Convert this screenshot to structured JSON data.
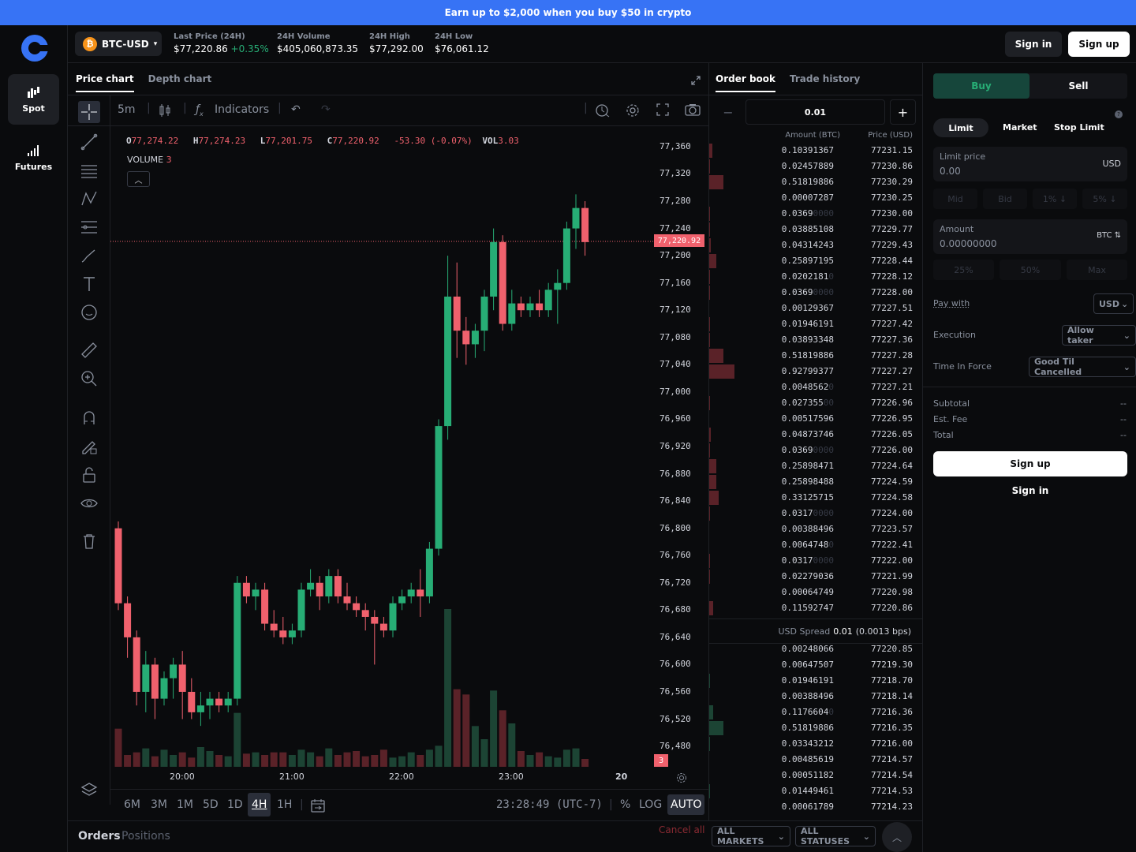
{
  "banner": {
    "text": "Earn up to $2,000 when you buy $50 in crypto"
  },
  "nav": {
    "spot": "Spot",
    "futures": "Futures"
  },
  "header": {
    "pair": "BTC-USD",
    "btc_symbol": "₿",
    "stats": [
      {
        "label": "Last Price (24H)",
        "value": "$77,220.86",
        "change": "+0.35%"
      },
      {
        "label": "24H Volume",
        "value": "$405,060,873.35"
      },
      {
        "label": "24H High",
        "value": "$77,292.00"
      },
      {
        "label": "24H Low",
        "value": "$76,061.12"
      }
    ],
    "sign_in": "Sign in",
    "sign_up": "Sign up"
  },
  "chart_tabs": {
    "price": "Price chart",
    "depth": "Depth chart"
  },
  "toolbar": {
    "interval": "5m",
    "indicators": "Indicators"
  },
  "legend": {
    "o_label": "O",
    "o": "77,274.22",
    "h_label": "H",
    "h": "77,274.23",
    "l_label": "L",
    "l": "77,201.75",
    "c_label": "C",
    "c": "77,220.92",
    "chg": "-53.30 (-0.07%)",
    "vol_label": "VOL",
    "vol": "3.03",
    "volume_label": "VOLUME",
    "volume_val": "3"
  },
  "chart_data": {
    "type": "candlestick",
    "x_ticks": [
      "20:00",
      "21:00",
      "22:00",
      "23:00"
    ],
    "y_ticks": [
      "77,360",
      "77,320",
      "77,280",
      "77,240",
      "77,200",
      "77,160",
      "77,120",
      "77,080",
      "77,040",
      "77,000",
      "76,960",
      "76,920",
      "76,880",
      "76,840",
      "76,800",
      "76,760",
      "76,720",
      "76,680",
      "76,640",
      "76,600",
      "76,560",
      "76,520",
      "76,480"
    ],
    "ylim": [
      76450,
      77390
    ],
    "last_price": "77,220.92",
    "volume_last": "3",
    "x_tail_label": "20",
    "candles": [
      [
        76800,
        76810,
        76680,
        76690
      ],
      [
        76690,
        76700,
        76610,
        76640
      ],
      [
        76640,
        76650,
        76540,
        76560
      ],
      [
        76560,
        76620,
        76530,
        76600
      ],
      [
        76600,
        76610,
        76520,
        76550
      ],
      [
        76550,
        76590,
        76540,
        76580
      ],
      [
        76580,
        76610,
        76550,
        76600
      ],
      [
        76600,
        76620,
        76520,
        76560
      ],
      [
        76560,
        76580,
        76520,
        76530
      ],
      [
        76530,
        76560,
        76510,
        76540
      ],
      [
        76540,
        76560,
        76520,
        76550
      ],
      [
        76550,
        76560,
        76530,
        76540
      ],
      [
        76540,
        76560,
        76530,
        76550
      ],
      [
        76550,
        76730,
        76540,
        76720
      ],
      [
        76720,
        76730,
        76690,
        76700
      ],
      [
        76700,
        76720,
        76680,
        76710
      ],
      [
        76710,
        76720,
        76650,
        76660
      ],
      [
        76660,
        76680,
        76640,
        76650
      ],
      [
        76650,
        76670,
        76630,
        76640
      ],
      [
        76640,
        76660,
        76630,
        76650
      ],
      [
        76650,
        76720,
        76640,
        76710
      ],
      [
        76710,
        76740,
        76700,
        76720
      ],
      [
        76720,
        76730,
        76680,
        76700
      ],
      [
        76700,
        76740,
        76690,
        76730
      ],
      [
        76730,
        76740,
        76690,
        76700
      ],
      [
        76700,
        76720,
        76680,
        76690
      ],
      [
        76690,
        76700,
        76670,
        76680
      ],
      [
        76680,
        76690,
        76650,
        76670
      ],
      [
        76670,
        76680,
        76600,
        76660
      ],
      [
        76660,
        76670,
        76640,
        76650
      ],
      [
        76650,
        76700,
        76640,
        76690
      ],
      [
        76690,
        76710,
        76680,
        76700
      ],
      [
        76700,
        76720,
        76690,
        76710
      ],
      [
        76710,
        76740,
        76670,
        76700
      ],
      [
        76700,
        76780,
        76690,
        76770
      ],
      [
        76770,
        76960,
        76760,
        76950
      ],
      [
        76950,
        77200,
        76930,
        77140
      ],
      [
        77140,
        77190,
        77050,
        77090
      ],
      [
        77090,
        77110,
        77040,
        77070
      ],
      [
        77070,
        77100,
        77050,
        77090
      ],
      [
        77090,
        77150,
        77060,
        77140
      ],
      [
        77140,
        77240,
        77120,
        77220
      ],
      [
        77220,
        77230,
        77090,
        77100
      ],
      [
        77100,
        77150,
        77090,
        77130
      ],
      [
        77130,
        77140,
        77110,
        77120
      ],
      [
        77120,
        77140,
        77110,
        77130
      ],
      [
        77130,
        77150,
        77110,
        77120
      ],
      [
        77120,
        77160,
        77110,
        77150
      ],
      [
        77150,
        77180,
        77100,
        77160
      ],
      [
        77160,
        77250,
        77150,
        77240
      ],
      [
        77240,
        77290,
        77210,
        77270
      ],
      [
        77270,
        77280,
        77200,
        77220
      ]
    ],
    "volumes": [
      2.9,
      0.9,
      1.1,
      1.4,
      0.8,
      1.3,
      0.9,
      1.1,
      0.7,
      1.5,
      1.2,
      0.9,
      0.8,
      4.1,
      1.0,
      1.1,
      0.9,
      1.1,
      1.1,
      0.9,
      1.3,
      1.1,
      0.8,
      1.4,
      0.9,
      1.1,
      1.2,
      0.8,
      0.9,
      1.3,
      0.7,
      0.8,
      1.1,
      0.9,
      1.3,
      1.6,
      12.0,
      5.9,
      5.5,
      3.1,
      2.1,
      5.8,
      4.3,
      3.3,
      1.2,
      0.9,
      1.1,
      0.8,
      0.7,
      1.3,
      1.4,
      0.6
    ]
  },
  "range": {
    "items": [
      "6M",
      "3M",
      "1M",
      "5D",
      "1D",
      "4H",
      "1H"
    ],
    "active": "4H",
    "clock": "23:28:49 (UTC-7)",
    "pct": "%",
    "log": "LOG",
    "auto": "AUTO"
  },
  "orders_bar": {
    "orders": "Orders",
    "positions": "Positions",
    "cancel_all": "Cancel all",
    "all_markets": "ALL MARKETS",
    "all_statuses": "ALL STATUSES"
  },
  "orderbook": {
    "tabs": {
      "book": "Order book",
      "history": "Trade history"
    },
    "increment": "0.01",
    "col_amount": "Amount (BTC)",
    "col_price": "Price (USD)",
    "asks": [
      {
        "a": "0.10391367",
        "d": "",
        "p": "77231.15",
        "v": 0.04
      },
      {
        "a": "0.02457889",
        "d": "",
        "p": "77230.86",
        "v": 0.01
      },
      {
        "a": "0.51819886",
        "d": "",
        "p": "77230.29",
        "v": 0.2
      },
      {
        "a": "0.00007287",
        "d": "",
        "p": "77230.25",
        "v": 0
      },
      {
        "a": "0.0369",
        "d": "0000",
        "p": "77230.00",
        "v": 0.01
      },
      {
        "a": "0.03885108",
        "d": "",
        "p": "77229.77",
        "v": 0.01
      },
      {
        "a": "0.04314243",
        "d": "",
        "p": "77229.43",
        "v": 0.02
      },
      {
        "a": "0.25897195",
        "d": "",
        "p": "77228.44",
        "v": 0.1
      },
      {
        "a": "0.0202181",
        "d": "0",
        "p": "77228.12",
        "v": 0.01
      },
      {
        "a": "0.0369",
        "d": "0000",
        "p": "77228.00",
        "v": 0.01
      },
      {
        "a": "0.00129367",
        "d": "",
        "p": "77227.51",
        "v": 0
      },
      {
        "a": "0.01946191",
        "d": "",
        "p": "77227.42",
        "v": 0.01
      },
      {
        "a": "0.03893348",
        "d": "",
        "p": "77227.36",
        "v": 0.01
      },
      {
        "a": "0.51819886",
        "d": "",
        "p": "77227.28",
        "v": 0.2
      },
      {
        "a": "0.92799377",
        "d": "",
        "p": "77227.27",
        "v": 0.35
      },
      {
        "a": "0.0048562",
        "d": "0",
        "p": "77227.21",
        "v": 0
      },
      {
        "a": "0.027355",
        "d": "00",
        "p": "77226.96",
        "v": 0.01
      },
      {
        "a": "0.00517596",
        "d": "",
        "p": "77226.95",
        "v": 0
      },
      {
        "a": "0.04873746",
        "d": "",
        "p": "77226.05",
        "v": 0.02
      },
      {
        "a": "0.0369",
        "d": "0000",
        "p": "77226.00",
        "v": 0.01
      },
      {
        "a": "0.25898471",
        "d": "",
        "p": "77224.64",
        "v": 0.1
      },
      {
        "a": "0.25898488",
        "d": "",
        "p": "77224.59",
        "v": 0.1
      },
      {
        "a": "0.33125715",
        "d": "",
        "p": "77224.58",
        "v": 0.13
      },
      {
        "a": "0.0317",
        "d": "0000",
        "p": "77224.00",
        "v": 0.01
      },
      {
        "a": "0.00388496",
        "d": "",
        "p": "77223.57",
        "v": 0
      },
      {
        "a": "0.0064748",
        "d": "0",
        "p": "77222.41",
        "v": 0
      },
      {
        "a": "0.0317",
        "d": "0000",
        "p": "77222.00",
        "v": 0.01
      },
      {
        "a": "0.02279036",
        "d": "",
        "p": "77221.99",
        "v": 0.01
      },
      {
        "a": "0.00064749",
        "d": "",
        "p": "77220.98",
        "v": 0
      },
      {
        "a": "0.11592747",
        "d": "",
        "p": "77220.86",
        "v": 0.05
      }
    ],
    "spread_label": "USD Spread",
    "spread_val": "0.01",
    "spread_bps": "(0.0013 bps)",
    "bids": [
      {
        "a": "0.00248066",
        "d": "",
        "p": "77220.85",
        "v": 0
      },
      {
        "a": "0.00647507",
        "d": "",
        "p": "77219.30",
        "v": 0
      },
      {
        "a": "0.01946191",
        "d": "",
        "p": "77218.70",
        "v": 0.01
      },
      {
        "a": "0.00388496",
        "d": "",
        "p": "77218.14",
        "v": 0
      },
      {
        "a": "0.1176604",
        "d": "0",
        "p": "77216.36",
        "v": 0.05
      },
      {
        "a": "0.51819886",
        "d": "",
        "p": "77216.35",
        "v": 0.2
      },
      {
        "a": "0.03343212",
        "d": "",
        "p": "77216.00",
        "v": 0.01
      },
      {
        "a": "0.00485619",
        "d": "",
        "p": "77214.57",
        "v": 0
      },
      {
        "a": "0.00051182",
        "d": "",
        "p": "77214.54",
        "v": 0
      },
      {
        "a": "0.01449461",
        "d": "",
        "p": "77214.53",
        "v": 0.01
      },
      {
        "a": "0.00061789",
        "d": "",
        "p": "77214.23",
        "v": 0
      }
    ]
  },
  "trade": {
    "buy": "Buy",
    "sell": "Sell",
    "order_types": [
      "Limit",
      "Market",
      "Stop Limit"
    ],
    "limit_price_label": "Limit price",
    "limit_price_value": "0.00",
    "limit_unit": "USD",
    "price_chips": [
      "Mid",
      "Bid",
      "1% ↓",
      "5% ↓"
    ],
    "amount_label": "Amount",
    "amount_value": "0.00000000",
    "amount_unit": "BTC ⇅",
    "amount_chips": [
      "25%",
      "50%",
      "Max"
    ],
    "pay_with_label": "Pay with",
    "pay_with_value": "USD",
    "execution_label": "Execution",
    "execution_value": "Allow taker",
    "tif_label": "Time In Force",
    "tif_value": "Good Til Cancelled",
    "subtotal_label": "Subtotal",
    "subtotal": "--",
    "fee_label": "Est. Fee",
    "fee": "--",
    "total_label": "Total",
    "total": "--",
    "sign_up": "Sign up",
    "sign_in": "Sign in"
  },
  "colors": {
    "up": "#27ad75",
    "down": "#f0616d",
    "accent": "#3773f5"
  }
}
